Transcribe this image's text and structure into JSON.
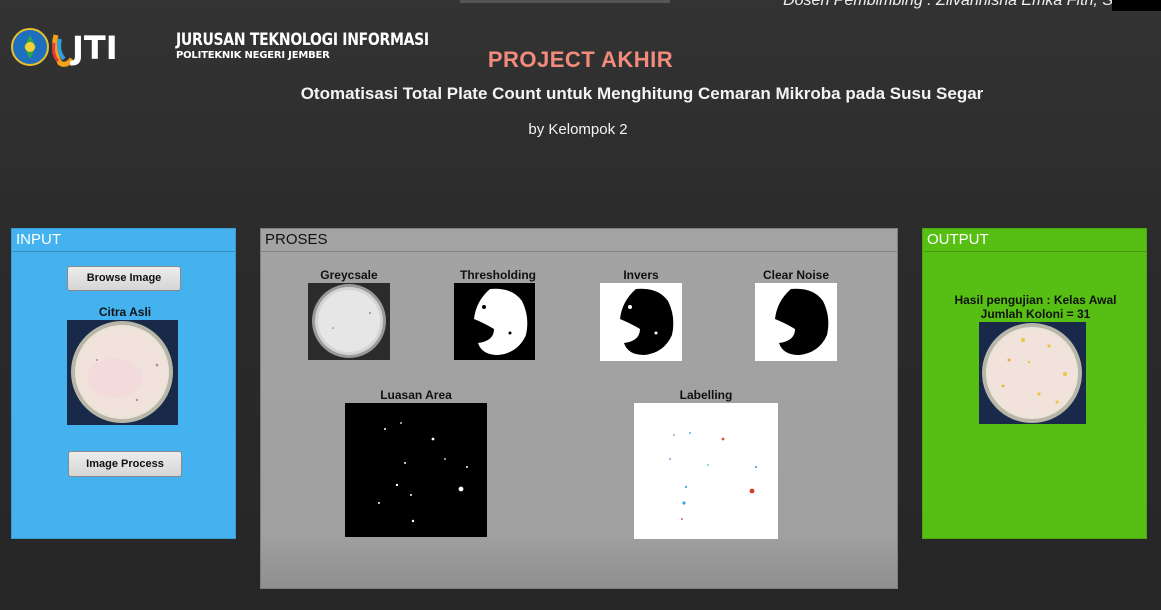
{
  "header": {
    "marquee": "Dosen Pembimbing : Zilvanhisna Emka Fitri, S",
    "logo_line1": "JURUSAN TEKNOLOGI INFORMASI",
    "logo_line2": "POLITEKNIK NEGERI JEMBER",
    "logo_mark": "JTI",
    "title": "PROJECT  AKHIR",
    "subtitle": "Otomatisasi Total Plate Count untuk Menghitung Cemaran Mikroba pada Susu Segar",
    "byline": "by Kelompok 2"
  },
  "input": {
    "title": "INPUT",
    "browse_label": "Browse Image",
    "image_label": "Citra Asli",
    "process_label": "Image Process"
  },
  "proses": {
    "title": "PROSES",
    "greyscale": "Greycsale",
    "threshold": "Thresholding",
    "invers": "Invers",
    "clear_noise": "Clear Noise",
    "luasan": "Luasan Area",
    "labelling": "Labelling"
  },
  "output": {
    "title": "OUTPUT",
    "result_line1": "Hasil pengujian : Kelas Awal",
    "result_line2": "Jumlah Koloni = 31"
  },
  "colors": {
    "title_color": "#f28b7b",
    "input_panel": "#43b2ef",
    "proses_panel": "#a3a3a3",
    "output_panel": "#57bf14"
  }
}
